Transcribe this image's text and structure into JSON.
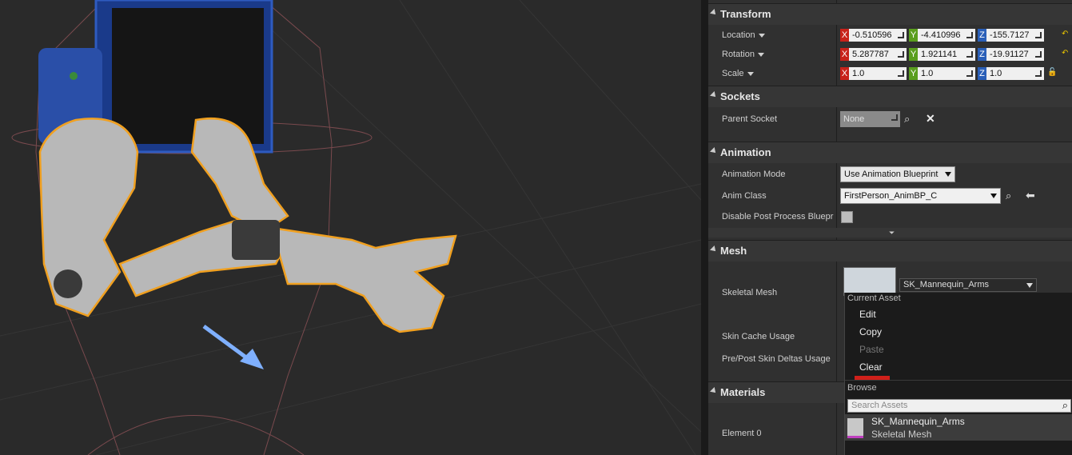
{
  "viewport": {
    "background": "#2a2a2a"
  },
  "details": {
    "sections": {
      "transform": "Transform",
      "sockets": "Sockets",
      "animation": "Animation",
      "mesh": "Mesh",
      "materials": "Materials"
    },
    "transform": {
      "location": {
        "label": "Location",
        "x": "-0.510596",
        "y": "-4.410996",
        "z": "-155.7127"
      },
      "rotation": {
        "label": "Rotation",
        "x": "5.287787",
        "y": "1.921141",
        "z": "-19.91127"
      },
      "scale": {
        "label": "Scale",
        "x": "1.0",
        "y": "1.0",
        "z": "1.0"
      },
      "axis_labels": {
        "x": "X",
        "y": "Y",
        "z": "Z"
      }
    },
    "sockets": {
      "parent_socket_label": "Parent Socket",
      "parent_socket_value": "None"
    },
    "animation": {
      "mode_label": "Animation Mode",
      "mode_value": "Use Animation Blueprint",
      "class_label": "Anim Class",
      "class_value": "FirstPerson_AnimBP_C",
      "disable_pp_label": "Disable Post Process Blueprint"
    },
    "mesh": {
      "skeletal_mesh_label": "Skeletal Mesh",
      "skeletal_mesh_value": "SK_Mannequin_Arms",
      "skin_cache_label": "Skin Cache Usage",
      "skin_deltas_label": "Pre/Post Skin Deltas Usage"
    },
    "materials": {
      "element0_label": "Element 0"
    }
  },
  "context_menu": {
    "current_asset_header": "Current Asset",
    "items": [
      "Edit",
      "Copy",
      "Paste",
      "Clear"
    ],
    "browse_header": "Browse",
    "search_placeholder": "Search Assets",
    "asset": {
      "name": "SK_Mannequin_Arms",
      "type": "Skeletal Mesh"
    }
  },
  "colors": {
    "selection_outline": "#f0a020",
    "axis_x": "#c8221a",
    "axis_y": "#5a9e1e",
    "axis_z": "#2a5fb8"
  }
}
